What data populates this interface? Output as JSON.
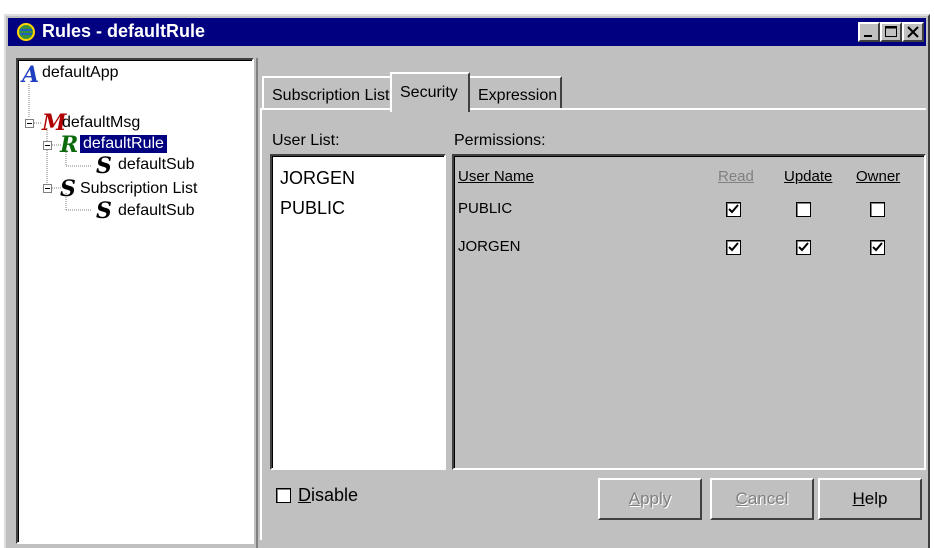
{
  "window": {
    "title": "Rules - defaultRule"
  },
  "tree": [
    {
      "label": "defaultApp",
      "icon": "A"
    },
    {
      "label": "defaultMsg",
      "icon": "M"
    },
    {
      "label": "defaultRule",
      "icon": "R"
    },
    {
      "label": "defaultSub",
      "icon": "S"
    },
    {
      "label": "Subscription List",
      "icon": "S"
    },
    {
      "label": "defaultSub",
      "icon": "S"
    }
  ],
  "tabs": [
    "Subscription List",
    "Security",
    "Expression"
  ],
  "active_tab": "Security",
  "user_list": {
    "label": "User List:",
    "users": [
      "JORGEN",
      "PUBLIC"
    ]
  },
  "permissions": {
    "label": "Permissions:",
    "columns": [
      "User Name",
      "Read",
      "Update",
      "Owner"
    ],
    "rows": [
      {
        "user": "PUBLIC",
        "read": true,
        "update": false,
        "owner": false
      },
      {
        "user": "JORGEN",
        "read": true,
        "update": true,
        "owner": true
      }
    ]
  },
  "disable": {
    "label_prefix": "D",
    "label_rest": "isable",
    "checked": false
  },
  "buttons": {
    "apply": {
      "u": "A",
      "rest": "pply"
    },
    "cancel": {
      "u": "C",
      "rest": "ancel"
    },
    "help": {
      "u": "H",
      "rest": "elp"
    }
  }
}
